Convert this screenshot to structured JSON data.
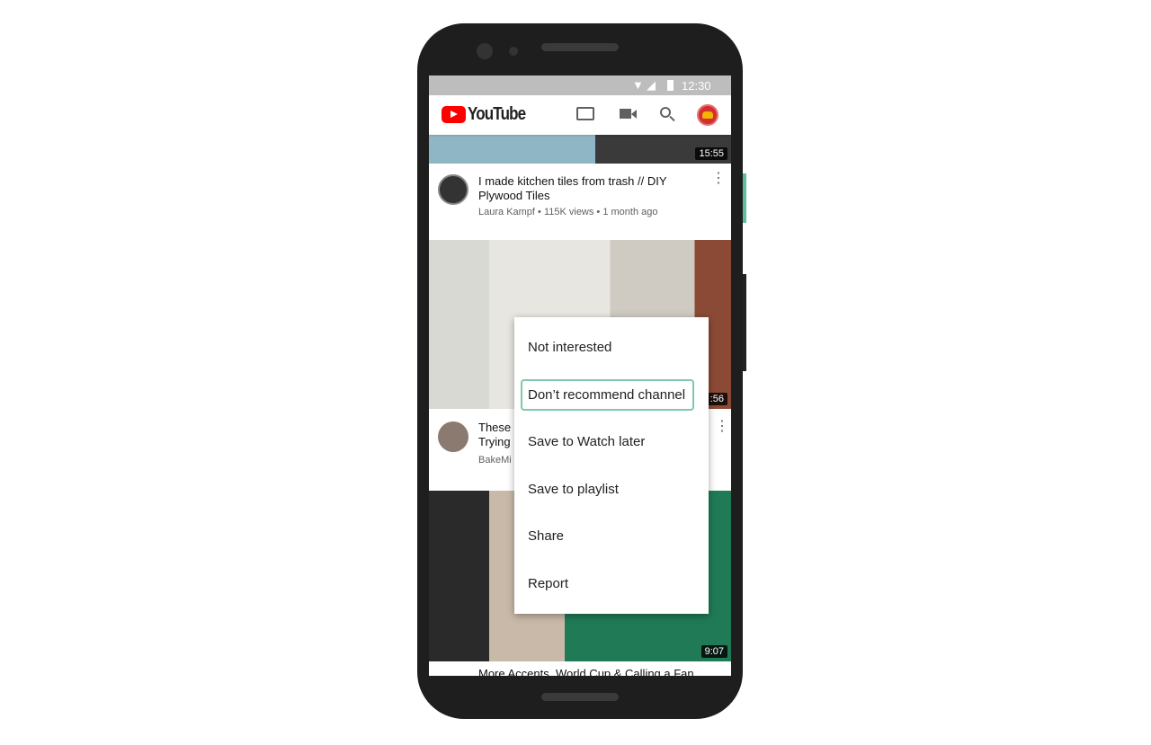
{
  "status": {
    "time": "12:30"
  },
  "header": {
    "logo": "YouTube",
    "brand_color": "#ff0000",
    "icons": [
      "cast-icon",
      "camera-icon",
      "search-icon",
      "account-avatar"
    ]
  },
  "videos": [
    {
      "duration": "15:55",
      "title": "I made kitchen tiles from trash // DIY Plywood Tiles",
      "meta": "Laura Kampf • 115K views • 1 month ago",
      "channel_avatar": "LAURA KAMPF"
    },
    {
      "duration": ":56",
      "title_line1": "These",
      "title_line2": "Trying",
      "meta": "BakeMi"
    },
    {
      "duration": "9:07",
      "title": "More Accents, World Cup & Calling a Fan"
    }
  ],
  "menu": {
    "items": [
      "Not interested",
      "Don’t recommend channel",
      "Save to Watch later",
      "Save to playlist",
      "Share",
      "Report"
    ],
    "selected_index": 1,
    "highlight_color": "#7fc8a9"
  }
}
